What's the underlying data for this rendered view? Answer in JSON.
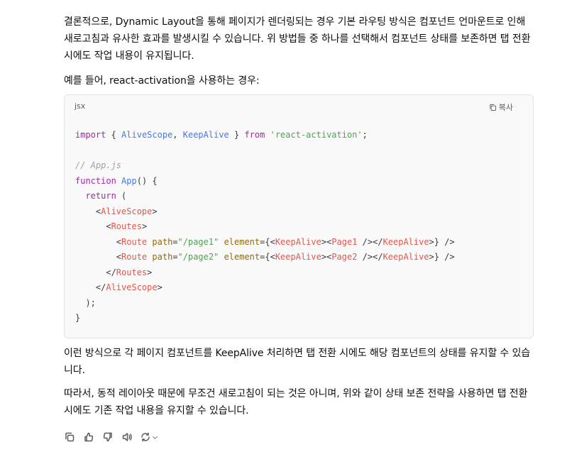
{
  "paragraphs": {
    "p1": "결론적으로, Dynamic Layout을 통해 페이지가 렌더링되는 경우 기본 라우팅 방식은 컴포넌트 언마운트로 인해 새로고침과 유사한 효과를 발생시킬 수 있습니다. 위 방법들 중 하나를 선택해서 컴포넌트 상태를 보존하면 탭 전환 시에도 작업 내용이 유지됩니다.",
    "p2": "예를 들어, react-activation을 사용하는 경우:",
    "p3": "이런 방식으로 각 페이지 컴포넌트를 KeepAlive 처리하면 탭 전환 시에도 해당 컴포넌트의 상태를 유지할 수 있습니다.",
    "p4": "따라서, 동적 레이아웃 때문에 무조건 새로고침이 되는 것은 아니며, 위와 같이 상태 보존 전략을 사용하면 탭 전환 시에도 기존 작업 내용을 유지할 수 있습니다."
  },
  "code_block": {
    "language": "jsx",
    "copy_label": "복사",
    "lines": [
      "import { AliveScope, KeepAlive } from 'react-activation';",
      "",
      "// App.js",
      "function App() {",
      "  return (",
      "    <AliveScope>",
      "      <Routes>",
      "        <Route path=\"/page1\" element={<KeepAlive><Page1 /></KeepAlive>} />",
      "        <Route path=\"/page2\" element={<KeepAlive><Page2 /></KeepAlive>} />",
      "      </Routes>",
      "    </AliveScope>",
      "  );",
      "}"
    ]
  },
  "actions": [
    "copy-icon",
    "thumbs-up-icon",
    "thumbs-down-icon",
    "read-aloud-icon",
    "regenerate-icon",
    "chevron-down-icon"
  ],
  "colors": {
    "keyword": "#a626a4",
    "function": "#4078f2",
    "string": "#50a14f",
    "tag": "#e45649",
    "attr": "#986801",
    "comment": "#a0a1a7"
  }
}
